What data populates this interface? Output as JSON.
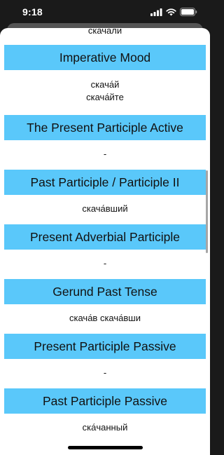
{
  "status": {
    "time": "9:18"
  },
  "top_partial_text": "скачали",
  "sections": [
    {
      "title": "Imperative Mood",
      "lines": [
        "скача́й",
        "скача́йте"
      ]
    },
    {
      "title": "The Present Participle Active",
      "lines": [
        "-"
      ]
    },
    {
      "title": "Past Participle / Participle II",
      "lines": [
        "скача́вший"
      ]
    },
    {
      "title": "Present Adverbial Participle",
      "lines": [
        "-"
      ]
    },
    {
      "title": "Gerund Past Tense",
      "lines": [
        "скача́в скача́вши"
      ]
    },
    {
      "title": "Present Participle Passive",
      "lines": [
        "-"
      ]
    },
    {
      "title": "Past Participle Passive",
      "lines": [
        "ска́чанный"
      ]
    }
  ],
  "colors": {
    "header_bg": "#5ac8fa",
    "sheet_bg": "#ffffff",
    "backdrop": "#1a1a1a"
  },
  "icons": [
    "cellular-signal-icon",
    "wifi-icon",
    "battery-icon"
  ]
}
